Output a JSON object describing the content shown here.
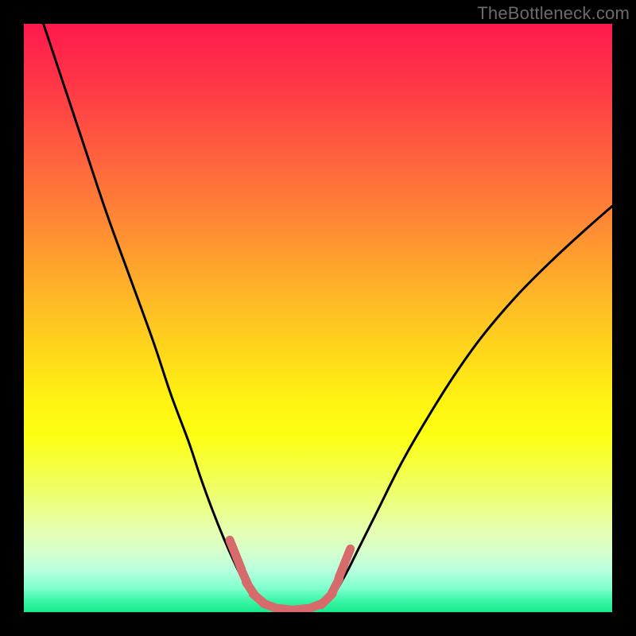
{
  "watermark": "TheBottleneck.com",
  "colors": {
    "background": "#000000",
    "curve": "#000000",
    "marker": "#d76b6b",
    "gradient_top": "#ff1a4d",
    "gradient_bottom": "#18e98e"
  },
  "chart_data": {
    "type": "line",
    "title": "",
    "xlabel": "",
    "ylabel": "",
    "xlim": [
      0,
      100
    ],
    "ylim": [
      0,
      100
    ],
    "grid": false,
    "note": "No numeric axes or tick labels present; values are read from geometric position within the plot area (0–100 each axis, y=0 at bottom).",
    "series": [
      {
        "name": "left-curve",
        "x": [
          3,
          6,
          10,
          14,
          18,
          22,
          25,
          28,
          30,
          32,
          34,
          36,
          37.5,
          39,
          41,
          43,
          45
        ],
        "y": [
          101,
          92,
          80,
          68,
          57,
          46,
          37,
          29,
          23,
          17.5,
          12.5,
          8,
          5,
          3,
          1.3,
          0.5,
          0.2
        ]
      },
      {
        "name": "valley-floor",
        "x": [
          39,
          41,
          43,
          45,
          47,
          49,
          51,
          52.5
        ],
        "y": [
          3,
          1.3,
          0.5,
          0.2,
          0.2,
          0.4,
          1.2,
          2.5
        ]
      },
      {
        "name": "right-curve",
        "x": [
          51,
          53,
          55,
          57,
          60,
          64,
          68,
          73,
          78,
          84,
          90,
          96,
          100
        ],
        "y": [
          1.2,
          3.5,
          7,
          11,
          17,
          25,
          32,
          40,
          47,
          54,
          60,
          65.5,
          69
        ]
      }
    ],
    "markers": {
      "name": "highlighted-points",
      "note": "Short pink dashed segments near the valley walls and floor.",
      "points": [
        {
          "x": 35.5,
          "y": 11
        },
        {
          "x": 36.5,
          "y": 8.5
        },
        {
          "x": 37.5,
          "y": 6
        },
        {
          "x": 38.5,
          "y": 4
        },
        {
          "x": 40.0,
          "y": 2.2
        },
        {
          "x": 42.0,
          "y": 1.0
        },
        {
          "x": 44.5,
          "y": 0.5
        },
        {
          "x": 47.0,
          "y": 0.5
        },
        {
          "x": 49.5,
          "y": 1.0
        },
        {
          "x": 51.5,
          "y": 2.2
        },
        {
          "x": 53.0,
          "y": 4.5
        },
        {
          "x": 54.0,
          "y": 7.0
        },
        {
          "x": 55.0,
          "y": 9.5
        }
      ]
    }
  }
}
